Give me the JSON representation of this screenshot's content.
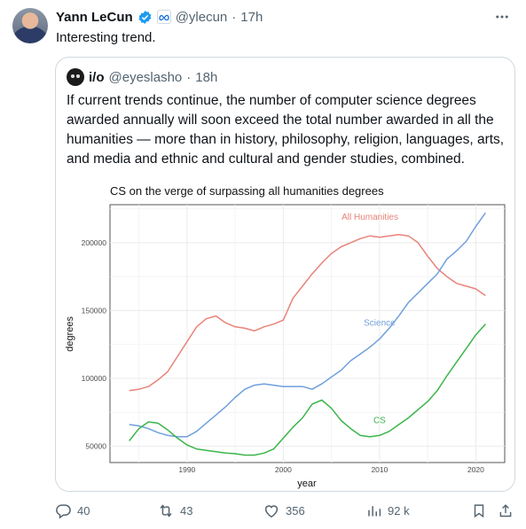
{
  "tweet": {
    "author": {
      "display_name": "Yann LeCun",
      "handle": "@ylecun",
      "dot": "·",
      "time": "17h"
    },
    "text": "Interesting trend.",
    "more_icon": "more-horizontal-icon",
    "verified_icon": "verified-badge-icon",
    "affiliation_icon": "meta-logo-icon"
  },
  "quoted_tweet": {
    "author": {
      "display_name": "i/o",
      "handle": "@eyeslasho",
      "dot": "·",
      "time": "18h"
    },
    "text": "If current trends continue, the number of computer science degrees awarded annually will soon exceed the total number awarded in all the humanities — more than in history, philosophy, religion, languages, arts, and media and ethnic and cultural and gender studies, combined."
  },
  "actions": {
    "reply": {
      "icon": "reply-icon",
      "count": "40"
    },
    "repost": {
      "icon": "repost-icon",
      "count": "43"
    },
    "like": {
      "icon": "heart-icon",
      "count": "356"
    },
    "views": {
      "icon": "views-chart-icon",
      "count": "92 k"
    },
    "bookmark": {
      "icon": "bookmark-icon"
    },
    "share": {
      "icon": "share-icon"
    }
  },
  "colors": {
    "all_humanities": "#e8837a",
    "science": "#6f9fdd",
    "cs": "#3bb54a",
    "panel_bg": "#ebebeb",
    "grid": "#ffffff",
    "muted_text": "#536471",
    "verified": "#1d9bf0"
  },
  "chart_data": {
    "type": "line",
    "title": "CS on the verge of surpassing all humanities degrees",
    "xlabel": "year",
    "ylabel": "degrees",
    "xlim": [
      1982,
      2023
    ],
    "ylim": [
      38000,
      228000
    ],
    "x_ticks": [
      1990,
      2000,
      2010,
      2020
    ],
    "y_ticks": [
      50000,
      100000,
      150000,
      200000
    ],
    "y_tick_labels": [
      "50000",
      "100000",
      "150000",
      "200000"
    ],
    "grid": true,
    "series": [
      {
        "name": "All Humanities",
        "color": "#e8837a",
        "x": [
          1984,
          1985,
          1986,
          1987,
          1988,
          1989,
          1990,
          1991,
          1992,
          1993,
          1994,
          1995,
          1996,
          1997,
          1998,
          1999,
          2000,
          2001,
          2002,
          2003,
          2004,
          2005,
          2006,
          2007,
          2008,
          2009,
          2010,
          2011,
          2012,
          2013,
          2014,
          2015,
          2016,
          2017,
          2018,
          2019,
          2020,
          2021
        ],
        "values": [
          91000,
          92000,
          94000,
          99000,
          105000,
          116000,
          127000,
          138000,
          144000,
          146000,
          141000,
          138000,
          137000,
          135000,
          138000,
          140000,
          143000,
          159000,
          168000,
          177000,
          185000,
          192000,
          197000,
          200000,
          203000,
          205000,
          204000,
          205000,
          206000,
          205000,
          200000,
          190000,
          181000,
          175000,
          170000,
          168000,
          166000,
          161000
        ]
      },
      {
        "name": "Science",
        "color": "#6f9fdd",
        "x": [
          1984,
          1985,
          1986,
          1987,
          1988,
          1989,
          1990,
          1991,
          1992,
          1993,
          1994,
          1995,
          1996,
          1997,
          1998,
          1999,
          2000,
          2001,
          2002,
          2003,
          2004,
          2005,
          2006,
          2007,
          2008,
          2009,
          2010,
          2011,
          2012,
          2013,
          2014,
          2015,
          2016,
          2017,
          2018,
          2019,
          2020,
          2021
        ],
        "values": [
          66000,
          65000,
          63000,
          60000,
          58000,
          57000,
          57000,
          61000,
          67000,
          73000,
          79000,
          86000,
          92000,
          95000,
          96000,
          95000,
          94000,
          94000,
          94000,
          92000,
          96000,
          101000,
          106000,
          113000,
          118000,
          123000,
          129000,
          137000,
          146000,
          156000,
          163000,
          170000,
          177000,
          188000,
          194000,
          201000,
          212000,
          222000
        ]
      },
      {
        "name": "CS",
        "color": "#3bb54a",
        "x": [
          1984,
          1985,
          1986,
          1987,
          1988,
          1989,
          1990,
          1991,
          1992,
          1993,
          1994,
          1995,
          1996,
          1997,
          1998,
          1999,
          2000,
          2001,
          2002,
          2003,
          2004,
          2005,
          2006,
          2007,
          2008,
          2009,
          2010,
          2011,
          2012,
          2013,
          2014,
          2015,
          2016,
          2017,
          2018,
          2019,
          2020,
          2021
        ],
        "values": [
          54000,
          63000,
          68000,
          67000,
          62000,
          56000,
          51000,
          48000,
          47000,
          46000,
          45000,
          44500,
          43500,
          43500,
          45000,
          48000,
          56000,
          64000,
          71000,
          81000,
          84000,
          78000,
          69000,
          63000,
          58000,
          57000,
          58000,
          61000,
          66000,
          71000,
          77000,
          83000,
          91000,
          102000,
          112000,
          122000,
          132000,
          140000
        ]
      }
    ],
    "series_labels": [
      {
        "name": "All Humanities",
        "x": 2009,
        "y": 217000
      },
      {
        "name": "Science",
        "x": 2010,
        "y": 139000
      },
      {
        "name": "CS",
        "x": 2010,
        "y": 67000
      }
    ]
  }
}
